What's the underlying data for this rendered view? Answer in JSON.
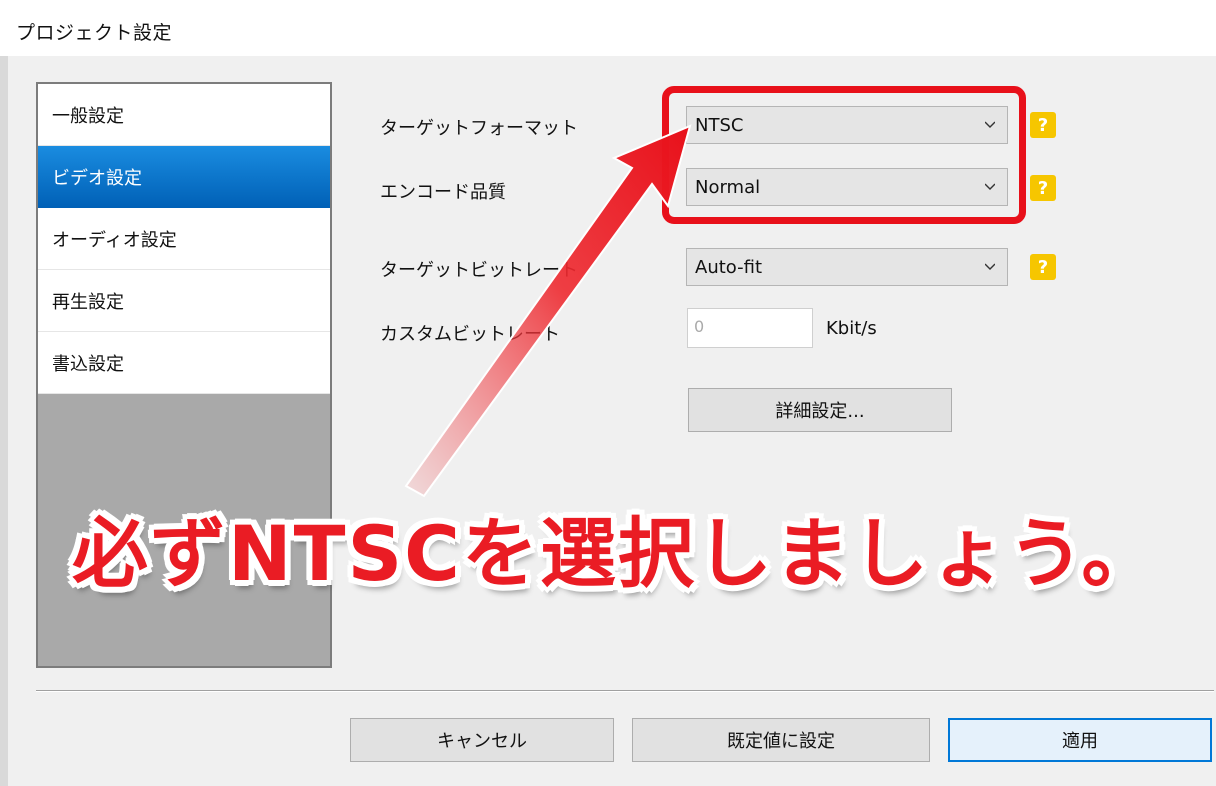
{
  "window": {
    "title": "プロジェクト設定"
  },
  "sidebar": {
    "items": [
      {
        "label": "一般設定",
        "selected": false
      },
      {
        "label": "ビデオ設定",
        "selected": true
      },
      {
        "label": "オーディオ設定",
        "selected": false
      },
      {
        "label": "再生設定",
        "selected": false
      },
      {
        "label": "書込設定",
        "selected": false
      }
    ]
  },
  "form": {
    "target_format": {
      "label": "ターゲットフォーマット",
      "value": "NTSC"
    },
    "encode_quality": {
      "label": "エンコード品質",
      "value": "Normal"
    },
    "target_bitrate": {
      "label": "ターゲットビットレート",
      "value": "Auto-fit"
    },
    "custom_bitrate": {
      "label": "カスタムビットレート",
      "value": "0",
      "unit": "Kbit/s"
    },
    "advanced_button": "詳細設定...",
    "help_glyph": "?"
  },
  "footer": {
    "cancel": "キャンセル",
    "reset_default": "既定値に設定",
    "apply": "適用"
  },
  "annotation": {
    "caption": "必ずNTSCを選択しましょう。",
    "color": "#ea1c24"
  },
  "colors": {
    "accent": "#0078d7",
    "selected_item": "#0a6fc8",
    "help_icon": "#f6c600"
  }
}
